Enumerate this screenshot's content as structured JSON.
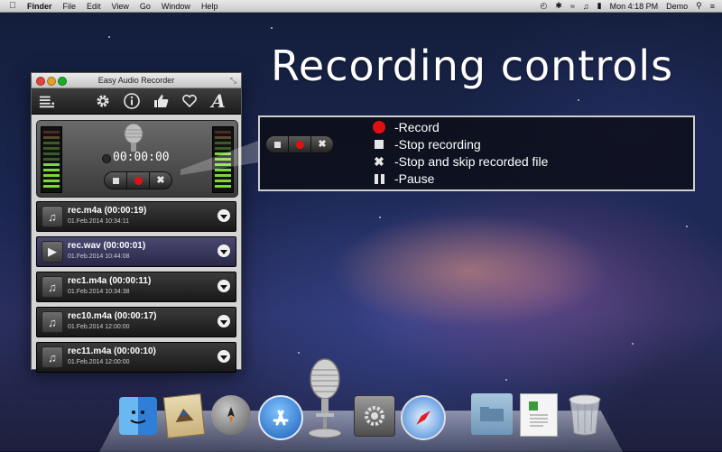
{
  "menubar": {
    "app": "Finder",
    "items": [
      "File",
      "Edit",
      "View",
      "Go",
      "Window",
      "Help"
    ],
    "clock": "Mon 4:18 PM",
    "user": "Demo"
  },
  "headline": "Recording controls",
  "window": {
    "title": "Easy Audio Recorder",
    "timer": "00:00:00",
    "recordings": [
      {
        "name": "rec.m4a (00:00:19)",
        "date": "01.Feb.2014 10:34:11",
        "icon": "music-note-icon"
      },
      {
        "name": "rec.wav (00:00:01)",
        "date": "01.Feb.2014 10:44:08",
        "icon": "play-icon",
        "active": true
      },
      {
        "name": "rec1.m4a (00:00:11)",
        "date": "01.Feb.2014 10:34:38",
        "icon": "music-note-icon"
      },
      {
        "name": "rec10.m4a (00:00:17)",
        "date": "01.Feb.2014 12:00:00",
        "icon": "music-note-icon"
      },
      {
        "name": "rec11.m4a (00:00:10)",
        "date": "01.Feb.2014 12:00:00",
        "icon": "music-note-icon"
      }
    ]
  },
  "callout": {
    "legend": [
      {
        "icon": "red-record-icon",
        "label": "-Record"
      },
      {
        "icon": "stop-square-icon",
        "label": "-Stop recording"
      },
      {
        "icon": "skip-x-icon",
        "label": "-Stop and skip recorded file"
      },
      {
        "icon": "pause-icon",
        "label": "-Pause"
      }
    ]
  },
  "colors": {
    "record": "#e01010",
    "accent_row": "#3d3a66"
  }
}
